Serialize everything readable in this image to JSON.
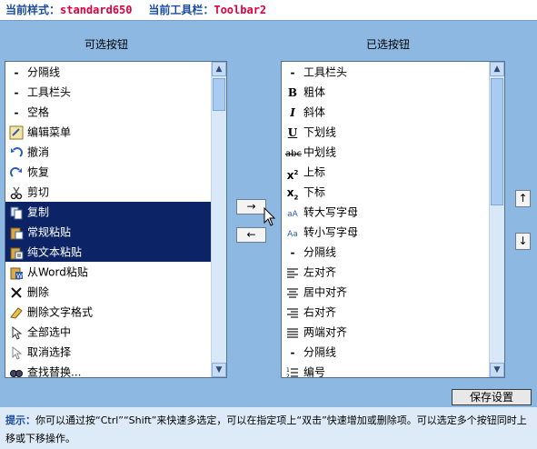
{
  "header": {
    "style_label": "当前样式：",
    "style_value": "standard650",
    "toolbar_label": "当前工具栏：",
    "toolbar_value": "Toolbar2"
  },
  "available": {
    "title": "可选按钮",
    "items": [
      {
        "icon": "dash-icon",
        "label": "分隔线",
        "selected": false
      },
      {
        "icon": "dash-icon",
        "label": "工具栏头",
        "selected": false
      },
      {
        "icon": "dash-icon",
        "label": "空格",
        "selected": false
      },
      {
        "icon": "edit-menu-icon",
        "label": "编辑菜单",
        "selected": false
      },
      {
        "icon": "undo-icon",
        "label": "撤消",
        "selected": false
      },
      {
        "icon": "redo-icon",
        "label": "恢复",
        "selected": false
      },
      {
        "icon": "cut-icon",
        "label": "剪切",
        "selected": false
      },
      {
        "icon": "copy-icon",
        "label": "复制",
        "selected": true
      },
      {
        "icon": "paste-icon",
        "label": "常规粘贴",
        "selected": true
      },
      {
        "icon": "paste-text-icon",
        "label": "纯文本粘贴",
        "selected": true
      },
      {
        "icon": "paste-word-icon",
        "label": "从Word粘贴",
        "selected": false
      },
      {
        "icon": "delete-icon",
        "label": "删除",
        "selected": false
      },
      {
        "icon": "remove-format-icon",
        "label": "删除文字格式",
        "selected": false
      },
      {
        "icon": "select-all-icon",
        "label": "全部选中",
        "selected": false
      },
      {
        "icon": "unselect-icon",
        "label": "取消选择",
        "selected": false
      },
      {
        "icon": "find-replace-icon",
        "label": "查找替换...",
        "selected": false
      }
    ]
  },
  "chosen": {
    "title": "已选按钮",
    "items": [
      {
        "icon": "dash-icon",
        "label": "工具栏头"
      },
      {
        "icon": "bold-icon",
        "label": "粗体"
      },
      {
        "icon": "italic-icon",
        "label": "斜体"
      },
      {
        "icon": "underline-icon",
        "label": "下划线"
      },
      {
        "icon": "strikethrough-icon",
        "label": "中划线"
      },
      {
        "icon": "superscript-icon",
        "label": "上标"
      },
      {
        "icon": "subscript-icon",
        "label": "下标"
      },
      {
        "icon": "uppercase-icon",
        "label": "转大写字母"
      },
      {
        "icon": "lowercase-icon",
        "label": "转小写字母"
      },
      {
        "icon": "dash-icon",
        "label": "分隔线"
      },
      {
        "icon": "align-left-icon",
        "label": "左对齐"
      },
      {
        "icon": "align-center-icon",
        "label": "居中对齐"
      },
      {
        "icon": "align-right-icon",
        "label": "右对齐"
      },
      {
        "icon": "justify-icon",
        "label": "两端对齐"
      },
      {
        "icon": "dash-icon",
        "label": "分隔线"
      },
      {
        "icon": "numbered-list-icon",
        "label": "编号"
      }
    ]
  },
  "buttons": {
    "add": "→",
    "remove": "←",
    "move_up": "↑",
    "move_down": "↓",
    "save": "保存设置"
  },
  "tip": {
    "label": "提示：",
    "text": "你可以通过按“Ctrl”“Shift”来快速多选定，可以在指定项上“双击”快速增加或删除项。可以选定多个按钮同时上移或下移操作。"
  },
  "colors": {
    "background": "#8CB8E2",
    "selection": "#0C2466",
    "header_value": "#E0003C",
    "header_label": "#1B4C9B"
  }
}
